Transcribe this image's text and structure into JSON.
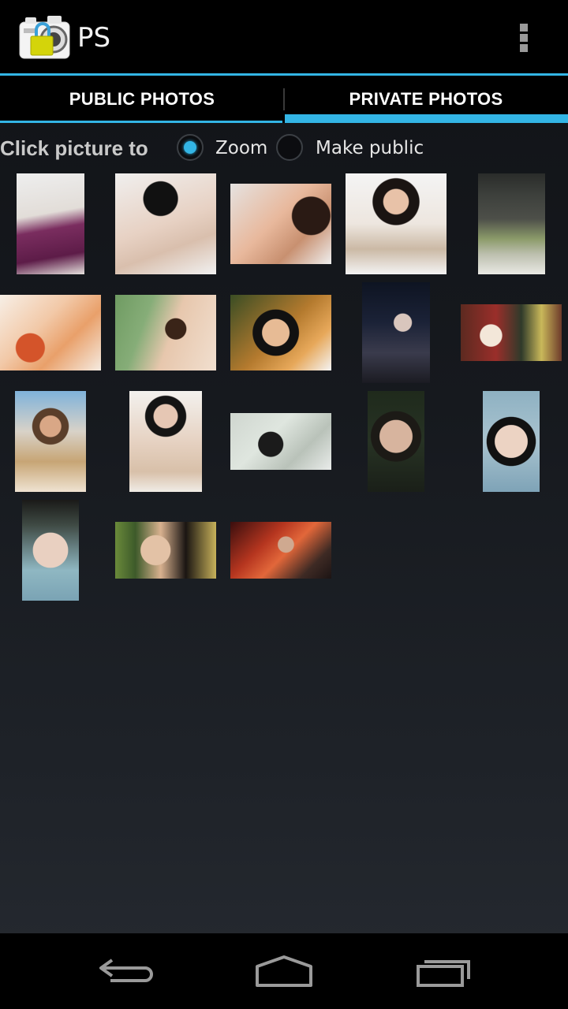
{
  "app": {
    "title": "PS",
    "icon": "camera-lock-icon",
    "menu_icon": "overflow-menu-icon"
  },
  "tabs": [
    {
      "label": "PUBLIC PHOTOS",
      "selected": false
    },
    {
      "label": "PRIVATE PHOTOS",
      "selected": true
    }
  ],
  "click_mode": {
    "label": "Click picture to",
    "options": [
      {
        "label": "Zoom",
        "checked": true
      },
      {
        "label": "Make public",
        "checked": false
      }
    ]
  },
  "photos_count": 18,
  "nav": {
    "back": "back-icon",
    "home": "home-icon",
    "recents": "recents-icon"
  },
  "colors": {
    "accent": "#33b5e5",
    "background": "#000000"
  }
}
